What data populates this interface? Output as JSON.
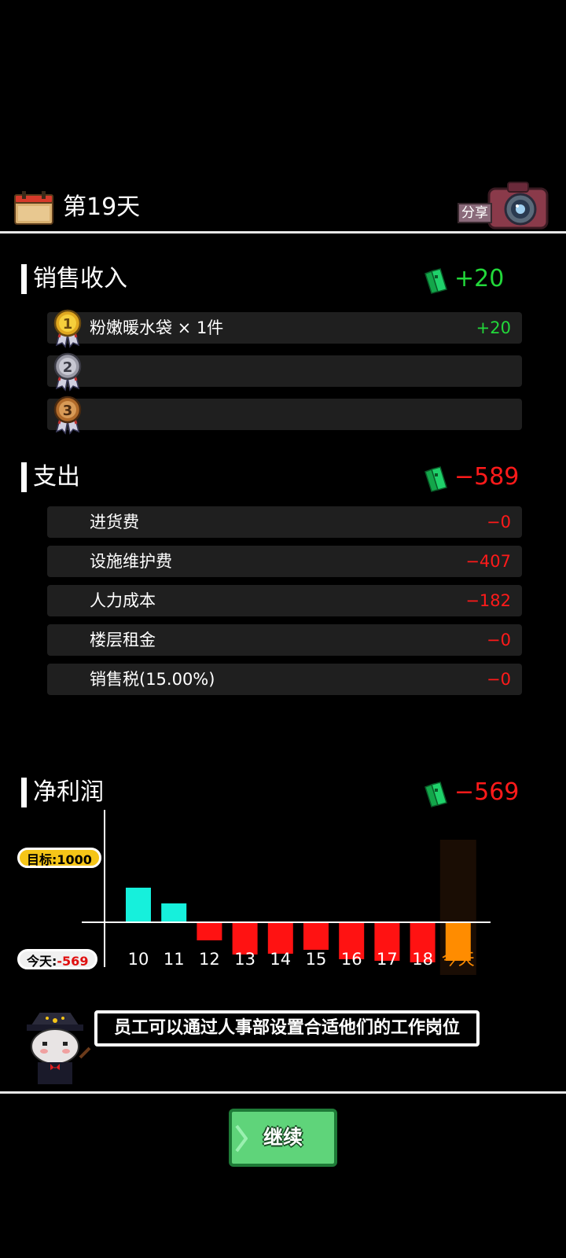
{
  "header": {
    "day_label": "第19天",
    "share_label": "分享"
  },
  "income": {
    "title": "销售收入",
    "total": "+20",
    "items": [
      {
        "rank": "1",
        "label": "粉嫩暖水袋 × 1件",
        "value": "+20"
      },
      {
        "rank": "2",
        "label": "",
        "value": ""
      },
      {
        "rank": "3",
        "label": "",
        "value": ""
      }
    ]
  },
  "expense": {
    "title": "支出",
    "total": "−589",
    "items": [
      {
        "label": "进货费",
        "value": "−0"
      },
      {
        "label": "设施维护费",
        "value": "−407"
      },
      {
        "label": "人力成本",
        "value": "−182"
      },
      {
        "label": "楼层租金",
        "value": "−0"
      },
      {
        "label": "销售税(15.00%)",
        "value": "−0"
      }
    ]
  },
  "profit": {
    "title": "净利润",
    "total": "−569",
    "target_label": "目标:1000",
    "today_prefix": "今天:",
    "today_value": "-569"
  },
  "chart_data": {
    "type": "bar",
    "categories": [
      "10",
      "11",
      "12",
      "13",
      "14",
      "15",
      "16",
      "17",
      "18",
      "今天"
    ],
    "values": [
      220,
      120,
      -110,
      -200,
      -195,
      -170,
      -230,
      -240,
      -250,
      -240
    ],
    "target": 1000,
    "ylim": [
      -400,
      640
    ]
  },
  "tip": {
    "text": "员工可以通过人事部设置合适他们的工作岗位"
  },
  "continue_label": "继续",
  "colors": {
    "positive": "#22d83a",
    "negative": "#ff1a1a",
    "bar_positive": "#16f0dc",
    "bar_negative": "#ff1212",
    "bar_today": "#ff8c00"
  }
}
